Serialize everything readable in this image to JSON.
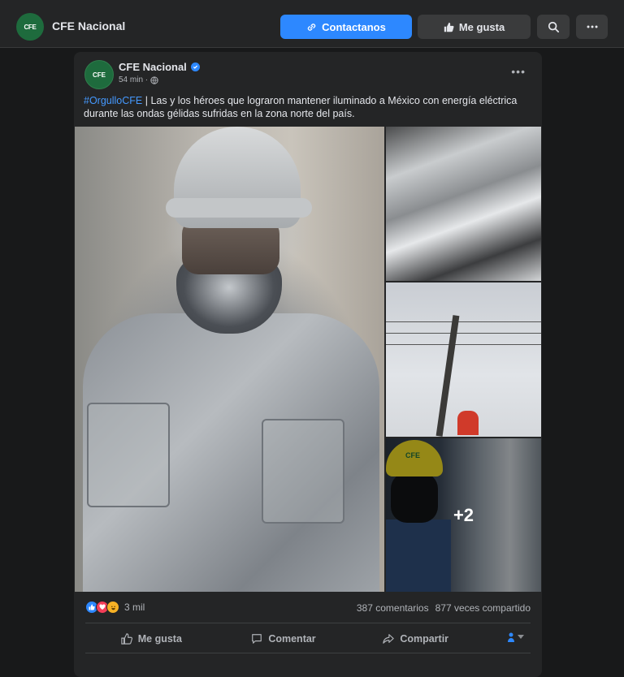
{
  "header": {
    "logo_text": "CFE",
    "page_name": "CFE Nacional",
    "contact_label": "Contactanos",
    "like_label": "Me gusta"
  },
  "post": {
    "author": "CFE Nacional",
    "time": "54 min ·",
    "hashtag": "#OrgulloCFE",
    "text": " | Las y los héroes que lograron mantener iluminado a México con energía eléctrica durante las ondas gélidas sufridas en la zona norte del país.",
    "more_photos": "+2",
    "photo_cfe_text": "CFE",
    "reactions_count": "3 mil",
    "comments": "387 comentarios",
    "shares": "877 veces compartido",
    "actions": {
      "like": "Me gusta",
      "comment": "Comentar",
      "share": "Compartir"
    }
  },
  "colors": {
    "accent": "#2d88ff",
    "background": "#18191a",
    "surface": "#242526",
    "brand_green": "#1e6b3d"
  }
}
